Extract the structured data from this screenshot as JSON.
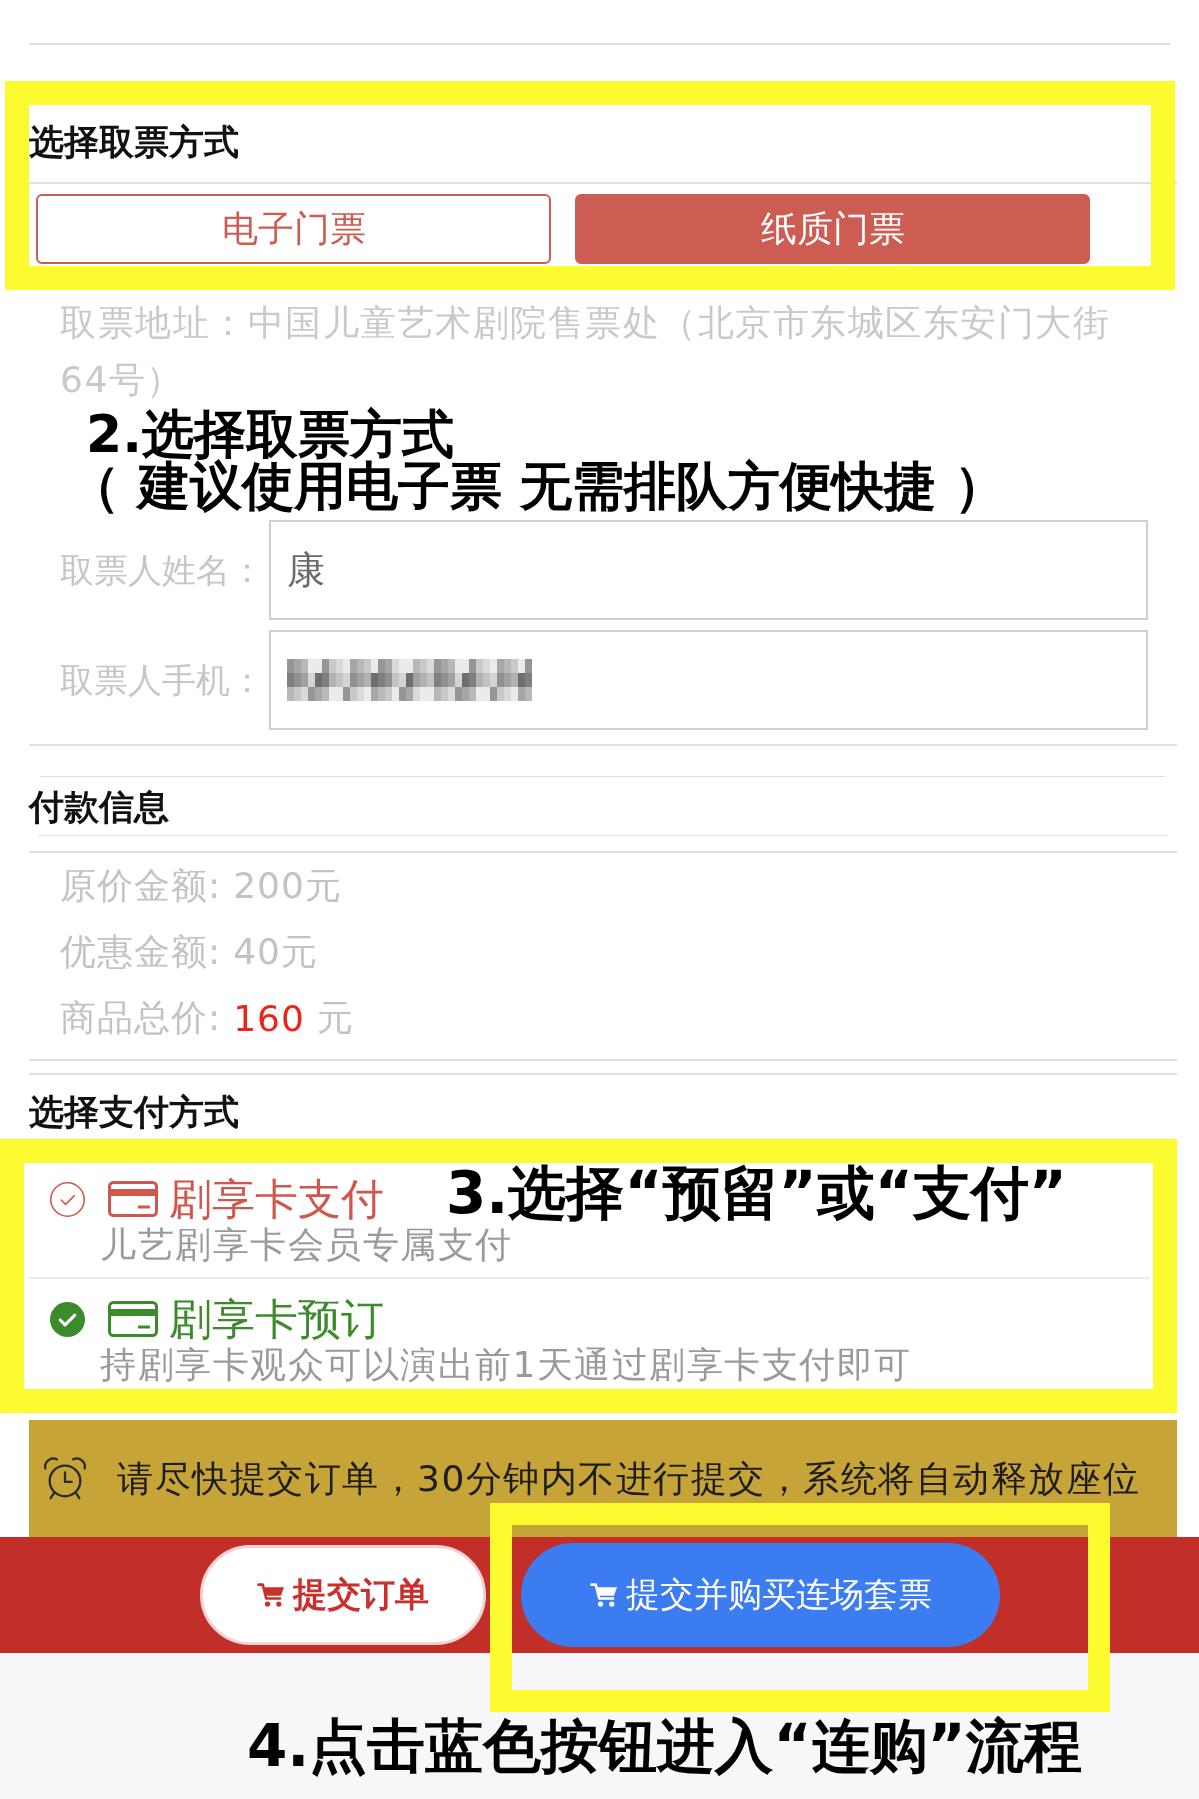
{
  "pickup": {
    "title": "选择取票方式",
    "options": [
      {
        "label": "电子门票",
        "selected": false
      },
      {
        "label": "纸质门票",
        "selected": true
      }
    ],
    "address": "取票地址：中国儿童艺术剧院售票处（北京市东城区东安门大街64号）",
    "fields": [
      {
        "label": "取票人姓名：",
        "value": "康",
        "redacted": false
      },
      {
        "label": "取票人手机：",
        "redacted": true
      }
    ]
  },
  "payment_info": {
    "title": "付款信息",
    "rows": [
      {
        "label": "原价金额:",
        "amount": "200元",
        "highlight": false
      },
      {
        "label": "优惠金额:",
        "amount": "40元",
        "highlight": false
      },
      {
        "label": "商品总价:",
        "amount": "160",
        "unit": "元",
        "highlight": true
      }
    ]
  },
  "payment_method": {
    "title": "选择支付方式",
    "methods": [
      {
        "title": "剧享卡支付",
        "subtitle": "儿艺剧享卡会员专属支付",
        "color": "#d0574d",
        "selected": false
      },
      {
        "title": "剧享卡预订",
        "subtitle": "持剧享卡观众可以演出前1天通过剧享卡支付即可",
        "color": "#3b8b2d",
        "selected": true
      }
    ]
  },
  "notice": {
    "text": "请尽快提交订单，30分钟内不进行提交，系统将自动释放座位"
  },
  "actions": [
    {
      "label": "提交订单",
      "kind": "secondary"
    },
    {
      "label": "提交并购买连场套票",
      "kind": "primary"
    }
  ],
  "annotations": [
    {
      "kind": "pickup",
      "lines": [
        "2.选择取票方式",
        "（ 建议使用电子票 无需排队方便快捷 ）"
      ]
    },
    {
      "kind": "payment",
      "lines": [
        "3.选择“预留”或“支付”"
      ]
    },
    {
      "kind": "submit",
      "lines": [
        "4.点击蓝色按钮进入“连购”流程"
      ]
    }
  ]
}
